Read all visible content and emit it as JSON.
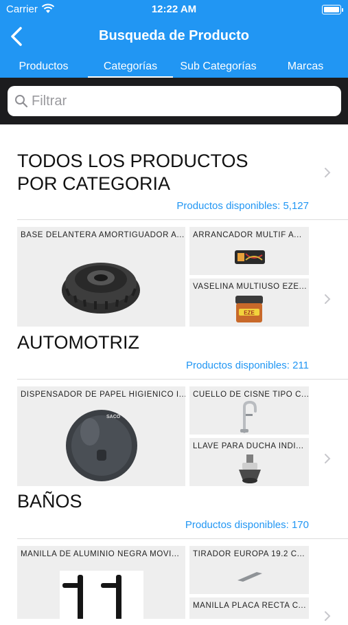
{
  "status": {
    "carrier": "Carrier",
    "time": "12:22 AM"
  },
  "header": {
    "title": "Busqueda de Producto"
  },
  "tabs": [
    {
      "label": "Productos"
    },
    {
      "label": "Categorías",
      "selected": true
    },
    {
      "label": "Sub Categorías"
    },
    {
      "label": "Marcas"
    }
  ],
  "search": {
    "placeholder": "Filtrar"
  },
  "all_products": {
    "title_line1": "TODOS LOS PRODUCTOS",
    "title_line2": "POR CATEGORIA",
    "available": "Productos disponibles: 5,127"
  },
  "categories": [
    {
      "name": "AUTOMOTRIZ",
      "available": "Productos disponibles: 211",
      "products": [
        "BASE DELANTERA AMORTIGUADOR A...",
        "ARRANCADOR MULTIF A...",
        "VASELINA MULTIUSO EZE..."
      ]
    },
    {
      "name": "BAÑOS",
      "available": "Productos disponibles: 170",
      "products": [
        "DISPENSADOR DE PAPEL HIGIENICO I...",
        "CUELLO DE CISNE TIPO C...",
        "LLAVE PARA DUCHA INDI..."
      ]
    },
    {
      "name": "",
      "available": "",
      "products": [
        "MANILLA DE ALUMINIO NEGRA MOVI...",
        "TIRADOR EUROPA 19.2 C...",
        "MANILLA PLACA RECTA C..."
      ]
    }
  ],
  "image_text": {
    "dispenser_brand": "SACO",
    "vaseline_brand": "EZE"
  },
  "colors": {
    "accent": "#2196f3",
    "search_band": "#1c1c1e",
    "tile_bg": "#eeeeee"
  }
}
